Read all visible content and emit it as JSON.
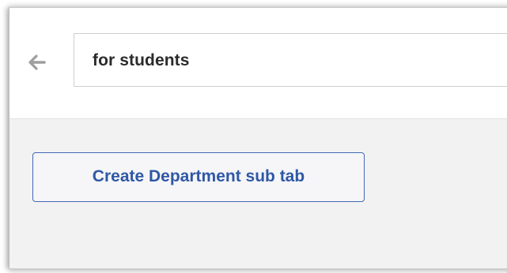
{
  "header": {
    "back_icon": "arrow-left-icon",
    "search": {
      "value": "for students"
    }
  },
  "main": {
    "create_button_label": "Create Department sub tab"
  },
  "colors": {
    "accent": "#2f58a6",
    "panel_background": "#f3f2f3",
    "header_background": "#ffffff",
    "back_icon": "#9e9e9e"
  }
}
